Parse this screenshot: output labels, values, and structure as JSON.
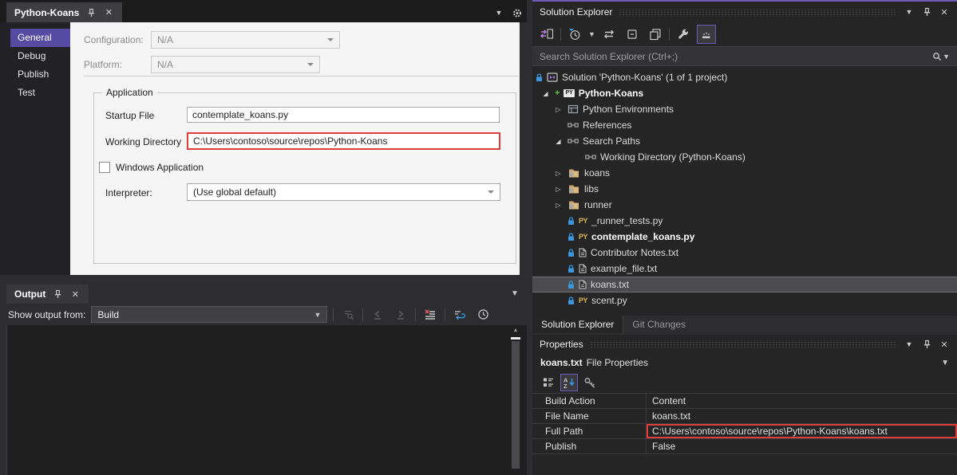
{
  "colors": {
    "accent_purple": "#564AA3",
    "selection_border_purple": "#6E5BB8",
    "error_red": "#E03C3C"
  },
  "document_tab": {
    "title": "Python-Koans"
  },
  "nav": {
    "items": [
      "General",
      "Debug",
      "Publish",
      "Test"
    ],
    "selected_index": 0
  },
  "designer": {
    "configuration_label": "Configuration:",
    "configuration_value": "N/A",
    "platform_label": "Platform:",
    "platform_value": "N/A",
    "application": {
      "group_label": "Application",
      "startup_file_label": "Startup File",
      "startup_file_value": "contemplate_koans.py",
      "working_directory_label": "Working Directory",
      "working_directory_value": "C:\\Users\\contoso\\source\\repos\\Python-Koans",
      "windows_application_label": "Windows Application",
      "windows_application_checked": false,
      "interpreter_label": "Interpreter:",
      "interpreter_value": "(Use global default)"
    }
  },
  "output": {
    "tab_title": "Output",
    "show_output_from_label": "Show output from:",
    "source_value": "Build"
  },
  "solution_explorer": {
    "title": "Solution Explorer",
    "search_placeholder": "Search Solution Explorer (Ctrl+;)",
    "tree": [
      {
        "label": "Solution 'Python-Koans' (1 of 1 project)",
        "icon": "solution",
        "level": 0,
        "glyph": "none",
        "locked": true
      },
      {
        "label": "Python-Koans",
        "icon": "project-py",
        "level": 1,
        "glyph": "expanded",
        "bold": true
      },
      {
        "label": "Python Environments",
        "icon": "py-env",
        "level": 2,
        "glyph": "collapsed"
      },
      {
        "label": "References",
        "icon": "box-link",
        "level": 2,
        "glyph": "none"
      },
      {
        "label": "Search Paths",
        "icon": "box-link",
        "level": 2,
        "glyph": "expanded"
      },
      {
        "label": "Working Directory (Python-Koans)",
        "icon": "box-link",
        "level": 3,
        "glyph": "none"
      },
      {
        "label": "koans",
        "icon": "folder-lock",
        "level": 2,
        "glyph": "collapsed"
      },
      {
        "label": "libs",
        "icon": "folder-lock",
        "level": 2,
        "glyph": "collapsed"
      },
      {
        "label": "runner",
        "icon": "folder-lock",
        "level": 2,
        "glyph": "collapsed"
      },
      {
        "label": "_runner_tests.py",
        "icon": "py-file",
        "level": 2,
        "glyph": "none",
        "locked": true
      },
      {
        "label": "contemplate_koans.py",
        "icon": "py-file",
        "level": 2,
        "glyph": "none",
        "locked": true,
        "bold": true
      },
      {
        "label": "Contributor Notes.txt",
        "icon": "txt-file",
        "level": 2,
        "glyph": "none",
        "locked": true
      },
      {
        "label": "example_file.txt",
        "icon": "txt-file",
        "level": 2,
        "glyph": "none",
        "locked": true
      },
      {
        "label": "koans.txt",
        "icon": "txt-file",
        "level": 2,
        "glyph": "none",
        "locked": true,
        "selected": true
      },
      {
        "label": "scent.py",
        "icon": "py-file",
        "level": 2,
        "glyph": "none",
        "locked": true
      }
    ],
    "bottom_tabs": [
      {
        "label": "Solution Explorer",
        "active": true
      },
      {
        "label": "Git Changes",
        "active": false
      }
    ]
  },
  "properties_panel": {
    "title": "Properties",
    "object_name": "koans.txt",
    "object_type": "File Properties",
    "rows": [
      {
        "name": "Build Action",
        "value": "Content"
      },
      {
        "name": "File Name",
        "value": "koans.txt"
      },
      {
        "name": "Full Path",
        "value": "C:\\Users\\contoso\\source\\repos\\Python-Koans\\koans.txt",
        "highlighted": true
      },
      {
        "name": "Publish",
        "value": "False"
      }
    ]
  }
}
